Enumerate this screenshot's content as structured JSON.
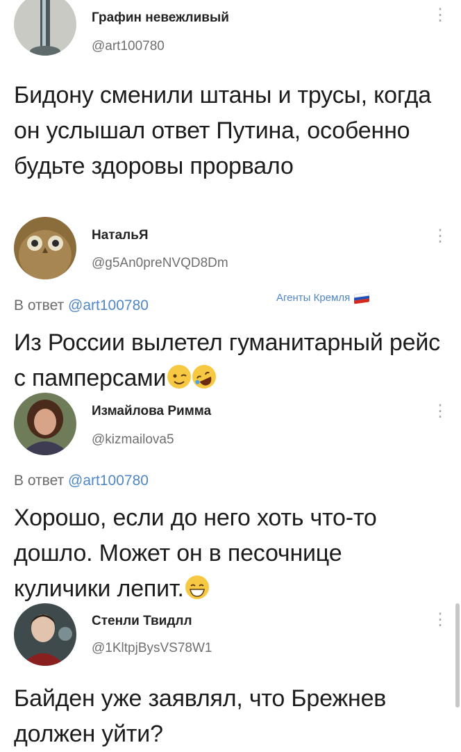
{
  "posts": [
    {
      "name": "Графин невежливый",
      "handle": "@art100780",
      "text": "Бидону сменили штаны и трусы, когда он услышал ответ Путина, особенно будьте здоровы прорвало"
    },
    {
      "name": "НатальЯ",
      "handle": "@g5An0preNVQD8Dm",
      "reply_prefix": "В ответ",
      "reply_to": "@art100780",
      "badge": "Агенты Кремля",
      "text": "Из России вылетел гуманитарный рейс с памперсами",
      "emojis": [
        "winking-face",
        "rolling-laughing-face"
      ]
    },
    {
      "name": "Измайлова Римма",
      "handle": "@kizmailova5",
      "reply_prefix": "В ответ",
      "reply_to": "@art100780",
      "text": "Хорошо, если до него хоть что-то дошло. Может он в песочнице куличики лепит.",
      "emojis": [
        "grinning-face"
      ]
    },
    {
      "name": "Стенли Твидлл",
      "handle": "@1KltpjBysVS78W1",
      "text": "Байден уже заявлял, что Брежнев должен уйти?"
    }
  ],
  "menu_icon": "vertical-ellipsis-icon",
  "colors": {
    "link": "#4f86c6",
    "muted": "#6f6f6f",
    "text": "#1c1c1c"
  }
}
